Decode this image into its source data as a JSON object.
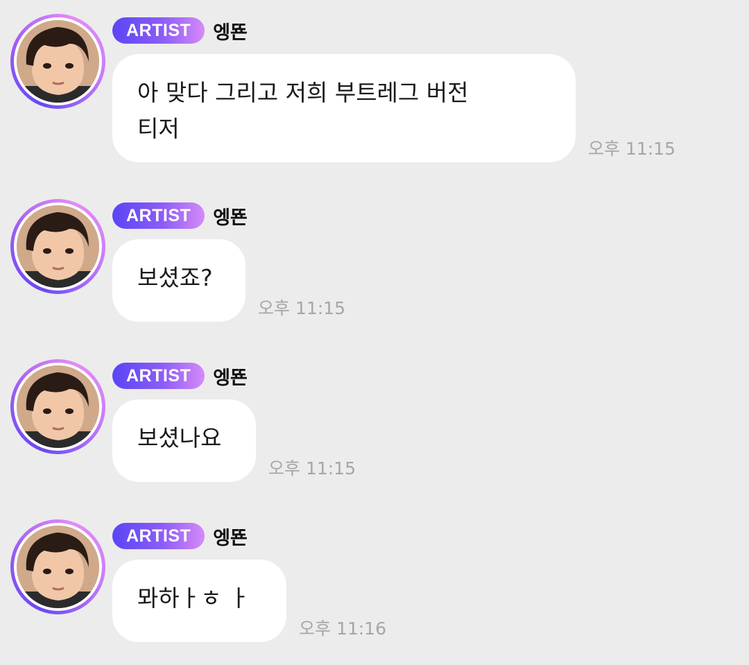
{
  "messages": [
    {
      "badge": "ARTIST",
      "sender": "엥뚄",
      "text_lines": [
        "아 맞다 그리고 저희 부트레그 버전",
        "티저"
      ],
      "time": "오후 11:15"
    },
    {
      "badge": "ARTIST",
      "sender": "엥뚄",
      "text_lines": [
        "보셨죠?"
      ],
      "time": "오후 11:15"
    },
    {
      "badge": "ARTIST",
      "sender": "엥뚄",
      "text_lines": [
        "보셨나요"
      ],
      "time": "오후 11:15"
    },
    {
      "badge": "ARTIST",
      "sender": "엥뚄",
      "text_lines": [
        "뫄하ㅏㅎ ㅏ"
      ],
      "time": "오후 11:16"
    }
  ],
  "colors": {
    "background": "#ececec",
    "bubble": "#ffffff",
    "badge_start": "#5a45f5",
    "badge_end": "#d68af8",
    "timestamp": "#a6a6a6"
  }
}
